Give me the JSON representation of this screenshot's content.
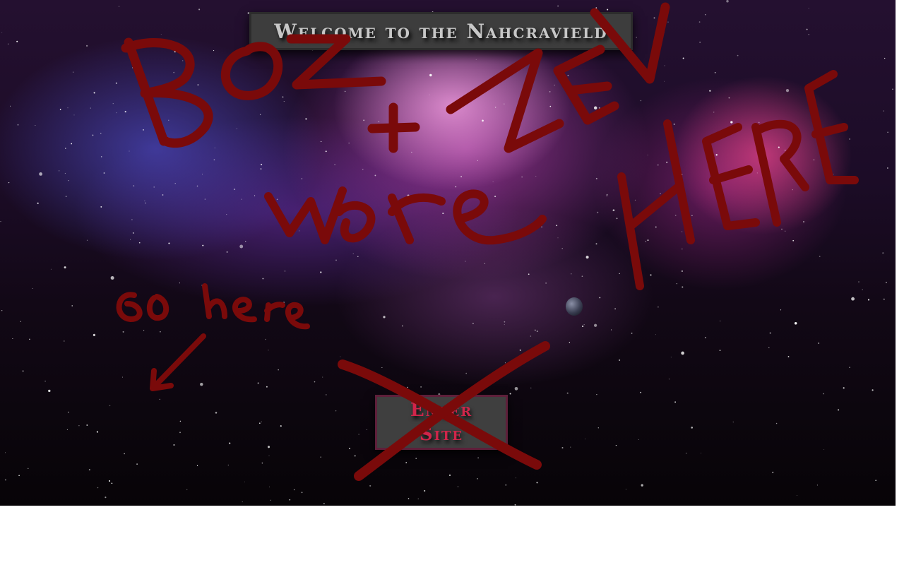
{
  "header": {
    "title": "Welcome to the Nahcravield"
  },
  "main": {
    "enter_label": "Enter Site"
  },
  "graffiti": {
    "line1": "BOZ + ZEV",
    "line2": "were HERE",
    "hint": "Go here"
  },
  "colors": {
    "ink": "#7a0a0a",
    "button_text": "#d0254a",
    "panel": "#3d3d3d",
    "page_bg": "#ffffff"
  }
}
